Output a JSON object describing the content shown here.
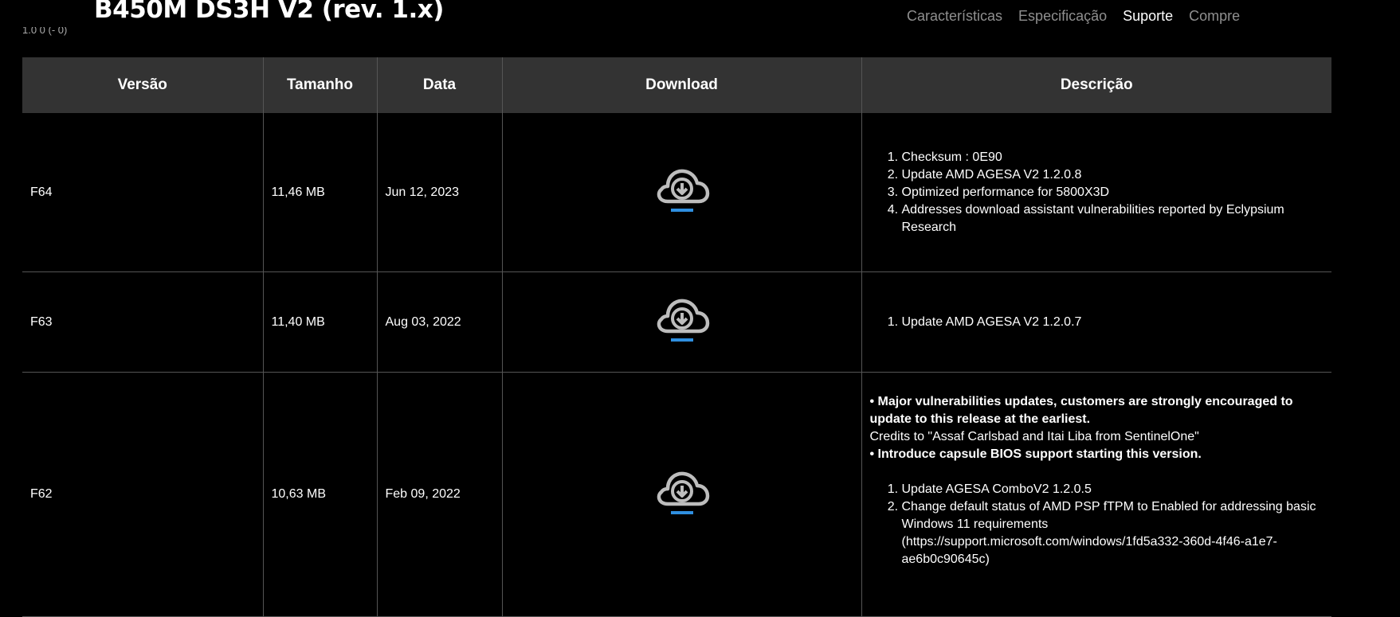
{
  "header": {
    "product_title": "B450M DS3H V2 (rev. 1.x)",
    "cut_text": "1.0 0 (- 0)",
    "nav": [
      {
        "label": "Características",
        "active": false
      },
      {
        "label": "Especificação",
        "active": false
      },
      {
        "label": "Suporte",
        "active": true
      },
      {
        "label": "Compre",
        "active": false
      }
    ]
  },
  "table": {
    "headers": [
      "Versão",
      "Tamanho",
      "Data",
      "Download",
      "Descrição"
    ],
    "rows": [
      {
        "version": "F64",
        "size": "11,46 MB",
        "date": "Jun 12, 2023",
        "download_icon": "cloud-download-icon",
        "description_items": [
          "Checksum : 0E90",
          "Update AMD AGESA V2 1.2.0.8",
          "Optimized performance for 5800X3D",
          "Addresses download assistant vulnerabilities reported by Eclypsium Research"
        ]
      },
      {
        "version": "F63",
        "size": "11,40 MB",
        "date": "Aug 03, 2022",
        "download_icon": "cloud-download-icon",
        "description_items": [
          "Update AMD AGESA V2 1.2.0.7"
        ]
      },
      {
        "version": "F62",
        "size": "10,63 MB",
        "date": "Feb 09, 2022",
        "download_icon": "cloud-download-icon",
        "description_bullets": [
          "• Major vulnerabilities updates, customers are strongly encouraged to update to this release at the earliest.",
          "Credits to \"Assaf Carlsbad and Itai Liba from SentinelOne\"",
          "• Introduce capsule BIOS support starting this version."
        ],
        "description_items": [
          "Update AGESA ComboV2 1.2.0.5",
          "Change default status of AMD PSP fTPM to Enabled for addressing basic Windows 11 requirements (https://support.microsoft.com/windows/1fd5a332-360d-4f46-a1e7-ae6b0c90645c)"
        ]
      }
    ]
  },
  "colors": {
    "background": "#000000",
    "header_row": "#333333",
    "nav_inactive": "#8f8f8f",
    "icon_gray": "#bdbdbd",
    "accent_blue": "#2f8fe0"
  }
}
